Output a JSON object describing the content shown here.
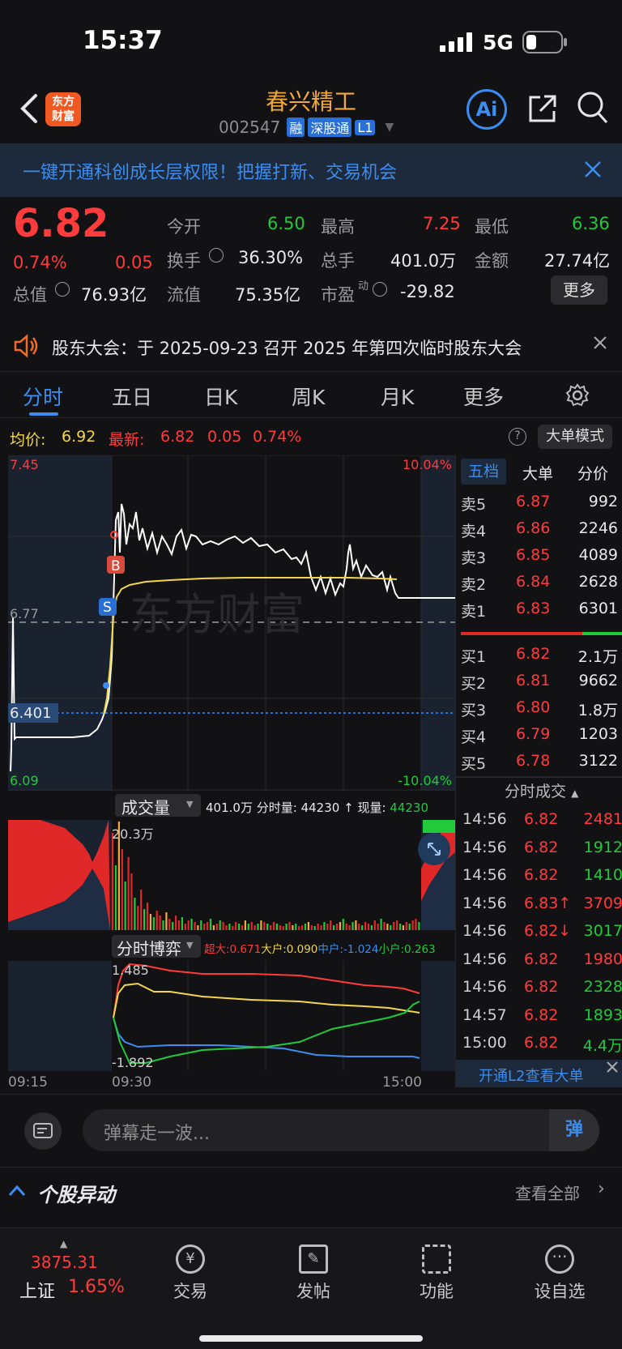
{
  "status": {
    "time": "15:37",
    "network": "5G"
  },
  "header": {
    "logo_line1": "东方",
    "logo_line2": "财富",
    "stock_name": "春兴精工",
    "stock_code": "002547",
    "tags": [
      "融",
      "深股通",
      "L1"
    ],
    "ai_label": "Ai"
  },
  "banner": {
    "text": "一键开通科创成长层权限！把握打新、交易机会"
  },
  "quote": {
    "price": "6.82",
    "pct": "0.74%",
    "chg": "0.05",
    "open_label": "今开",
    "open": "6.50",
    "high_label": "最高",
    "high": "7.25",
    "low_label": "最低",
    "low": "6.36",
    "turnover_label": "换手",
    "turnover": "36.30%",
    "volume_label": "总手",
    "volume": "401.0万",
    "amount_label": "金额",
    "amount": "27.74亿",
    "mktcap_label": "总值",
    "mktcap": "76.93亿",
    "float_label": "流值",
    "float": "75.35亿",
    "pe_label": "市盈",
    "pe_sup": "动",
    "pe": "-29.82",
    "more": "更多"
  },
  "notice": {
    "text": "股东大会：于 2025-09-23 召开 2025 年第四次临时股东大会"
  },
  "tabs": [
    "分时",
    "五日",
    "日K",
    "周K",
    "月K",
    "更多"
  ],
  "price_line": {
    "avg_label": "均价:",
    "avg": "6.92",
    "latest_label": "最新:",
    "latest": "6.82",
    "chg": "0.05",
    "pct": "0.74%",
    "mode_btn": "大单模式"
  },
  "chart": {
    "y_top": "7.45",
    "y_top_pct": "10.04%",
    "y_mid": "6.77",
    "y_bottom": "6.09",
    "y_bottom_pct": "-10.04%",
    "cursor": "6.401",
    "watermark": "东方财富",
    "marker_b": "B",
    "marker_s": "S"
  },
  "volume": {
    "selector": "成交量",
    "total": "401.0万",
    "min_label": "分时量:",
    "min_val": "44230",
    "arrow": "↑",
    "now_label": "现量:",
    "now_val": "44230",
    "max": "20.3万"
  },
  "game": {
    "selector": "分时博弈",
    "xl": "超大:0.671",
    "l": "大户:0.090",
    "m": "中户:-1.024",
    "s": "小户:0.263",
    "top": "1.485",
    "bottom": "-1.892"
  },
  "xaxis": [
    "09:15",
    "09:30",
    "15:00"
  ],
  "orderbook": {
    "tabs": [
      "五档",
      "大单",
      "分价"
    ],
    "sells": [
      {
        "label": "卖5",
        "price": "6.87",
        "vol": "992"
      },
      {
        "label": "卖4",
        "price": "6.86",
        "vol": "2246"
      },
      {
        "label": "卖3",
        "price": "6.85",
        "vol": "4089"
      },
      {
        "label": "卖2",
        "price": "6.84",
        "vol": "2628"
      },
      {
        "label": "卖1",
        "price": "6.83",
        "vol": "6301"
      }
    ],
    "buys": [
      {
        "label": "买1",
        "price": "6.82",
        "vol": "2.1万"
      },
      {
        "label": "买2",
        "price": "6.81",
        "vol": "9662"
      },
      {
        "label": "买3",
        "price": "6.80",
        "vol": "1.8万"
      },
      {
        "label": "买4",
        "price": "6.79",
        "vol": "1203"
      },
      {
        "label": "买5",
        "price": "6.78",
        "vol": "3122"
      }
    ]
  },
  "trades": {
    "title": "分时成交",
    "rows": [
      {
        "t": "14:56",
        "p": "6.82",
        "v": "2481",
        "c": "red"
      },
      {
        "t": "14:56",
        "p": "6.82",
        "v": "1912",
        "c": "green"
      },
      {
        "t": "14:56",
        "p": "6.82",
        "v": "1410",
        "c": "green"
      },
      {
        "t": "14:56",
        "p": "6.83↑",
        "v": "3709",
        "c": "red"
      },
      {
        "t": "14:56",
        "p": "6.82↓",
        "v": "3017",
        "c": "green"
      },
      {
        "t": "14:56",
        "p": "6.82",
        "v": "1980",
        "c": "red"
      },
      {
        "t": "14:56",
        "p": "6.82",
        "v": "2328",
        "c": "green"
      },
      {
        "t": "14:57",
        "p": "6.82",
        "v": "1893",
        "c": "green"
      },
      {
        "t": "15:00",
        "p": "6.82",
        "v": "4.4万",
        "c": "green"
      }
    ],
    "l2": "开通L2查看大单"
  },
  "danmu": {
    "placeholder": "弹幕走一波...",
    "btn": "弹"
  },
  "movement": {
    "title": "个股异动",
    "link": "查看全部"
  },
  "bottom": {
    "index_val": "3875.31",
    "index_name": "上证",
    "index_pct": "1.65%",
    "items": [
      "交易",
      "发帖",
      "功能",
      "设自选"
    ]
  }
}
